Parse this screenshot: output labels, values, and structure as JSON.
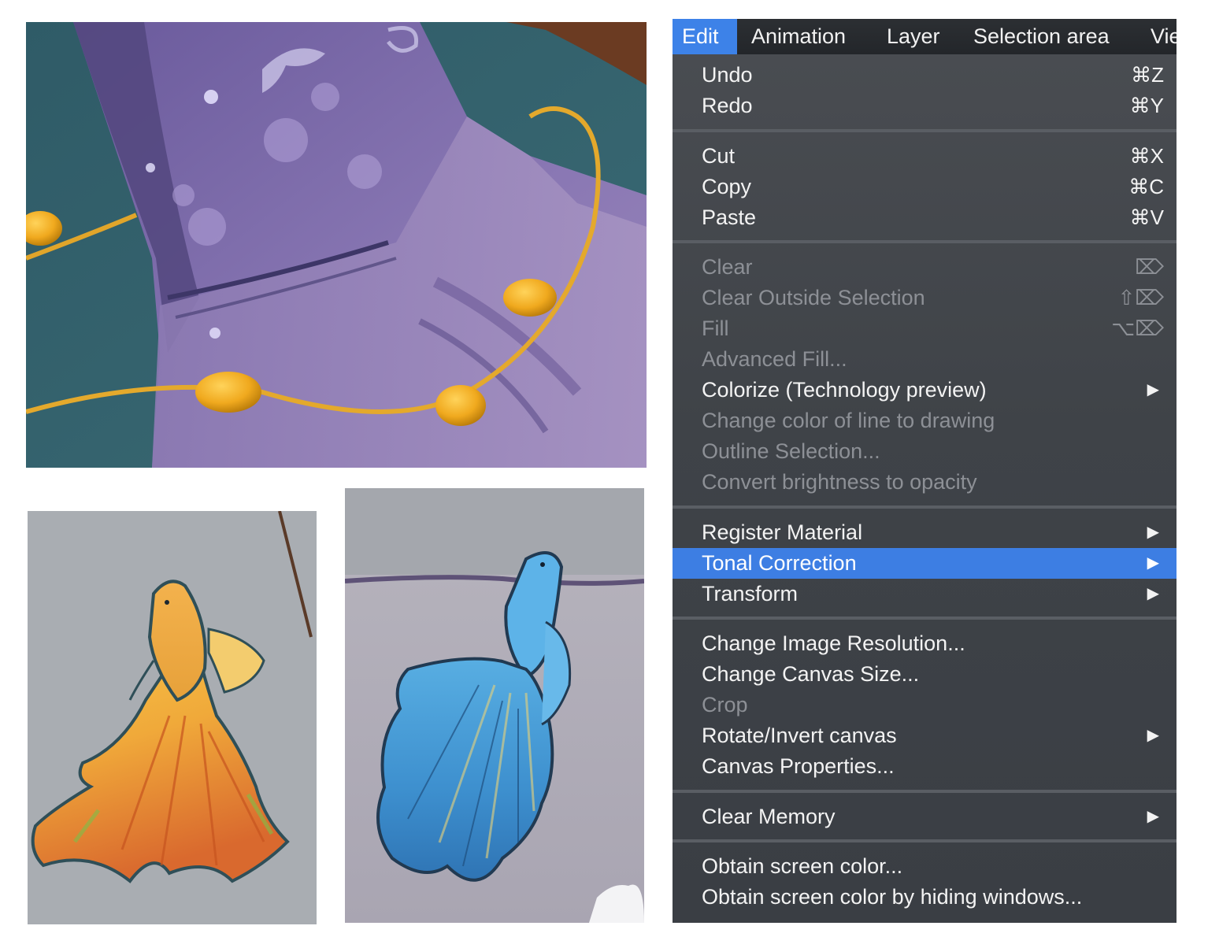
{
  "menubar": {
    "items": [
      "Edit",
      "Animation",
      "Layer",
      "Selection area",
      "Vie"
    ]
  },
  "menu": {
    "undo": {
      "label": "Undo",
      "shortcut": "⌘Z"
    },
    "redo": {
      "label": "Redo",
      "shortcut": "⌘Y"
    },
    "cut": {
      "label": "Cut",
      "shortcut": "⌘X"
    },
    "copy": {
      "label": "Copy",
      "shortcut": "⌘C"
    },
    "paste": {
      "label": "Paste",
      "shortcut": "⌘V"
    },
    "clear": {
      "label": "Clear",
      "shortcut": "⌦"
    },
    "clear_outside": {
      "label": "Clear Outside Selection",
      "shortcut": "⇧⌦"
    },
    "fill": {
      "label": "Fill",
      "shortcut": "⌥⌦"
    },
    "advanced_fill": {
      "label": "Advanced Fill..."
    },
    "colorize": {
      "label": "Colorize (Technology preview)"
    },
    "change_line_color": {
      "label": "Change color of line to drawing"
    },
    "outline_selection": {
      "label": "Outline Selection..."
    },
    "brightness_opacity": {
      "label": "Convert brightness to opacity"
    },
    "register_material": {
      "label": "Register Material"
    },
    "tonal_correction": {
      "label": "Tonal Correction"
    },
    "transform": {
      "label": "Transform"
    },
    "image_resolution": {
      "label": "Change Image Resolution..."
    },
    "canvas_size": {
      "label": "Change Canvas Size..."
    },
    "crop": {
      "label": "Crop"
    },
    "rotate_invert": {
      "label": "Rotate/Invert canvas"
    },
    "canvas_properties": {
      "label": "Canvas Properties..."
    },
    "clear_memory": {
      "label": "Clear Memory"
    },
    "obtain_color": {
      "label": "Obtain screen color..."
    },
    "obtain_color_hiding": {
      "label": "Obtain screen color by hiding windows..."
    },
    "submenu_arrow": "▶"
  },
  "colors": {
    "highlight": "#3d7ee3",
    "menu_bg": "#43474c",
    "disabled_text": "#8d9096"
  }
}
